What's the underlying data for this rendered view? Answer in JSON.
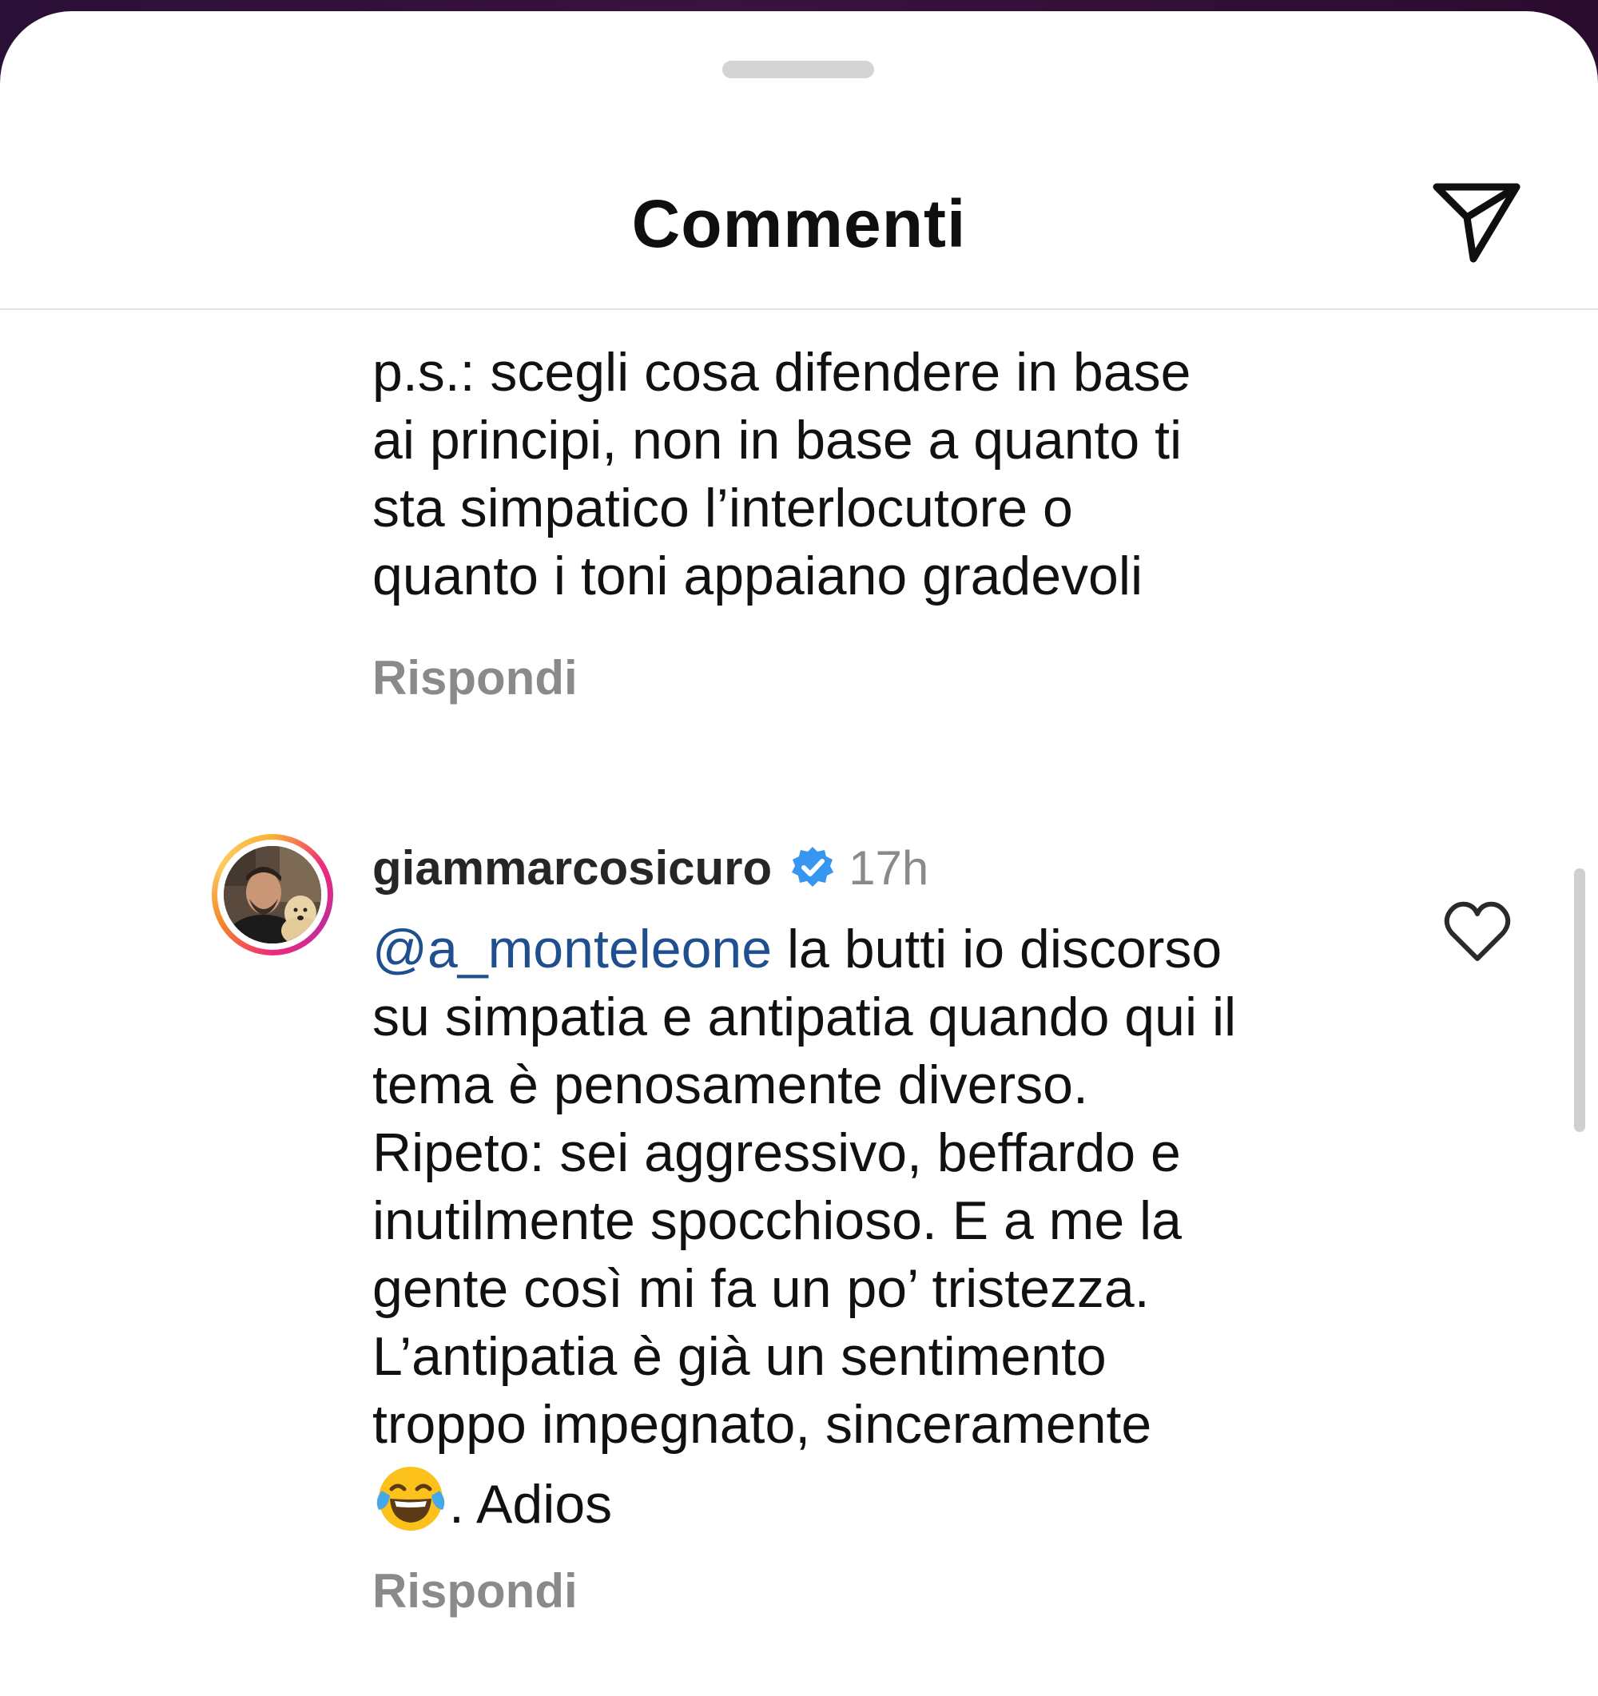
{
  "header": {
    "title": "Commenti",
    "share_icon": "paper-plane-icon"
  },
  "comments": [
    {
      "text": "p.s.: scegli cosa difendere in base\nai principi, non in base a quanto ti\nsta simpatico l’interlocutore o\nquanto i toni appaiano gradevoli",
      "reply_label": "Rispondi"
    },
    {
      "username": "giammarcosicuro",
      "verified": true,
      "timestamp": "17h",
      "mention": "@a_monteleone",
      "text_main": " la butti io discorso\nsu simpatia e antipatia quando qui il\ntema è penosamente diverso.\nRipeto: sei aggressivo, beffardo e\ninutilmente spocchioso. E a me la\ngente così mi fa un po’ tristezza.\nL’antipatia è già un sentimento\ntroppo impegnato, sinceramente\n",
      "emoji": "face-with-tears-of-joy",
      "text_tail": ". Adios",
      "reply_label": "Rispondi",
      "like_icon": "heart-outline-icon"
    }
  ],
  "colors": {
    "mention": "#1f4f8f",
    "verified": "#3797f0",
    "secondary_text": "#8a8a8a",
    "backdrop": "#2a0f36"
  }
}
